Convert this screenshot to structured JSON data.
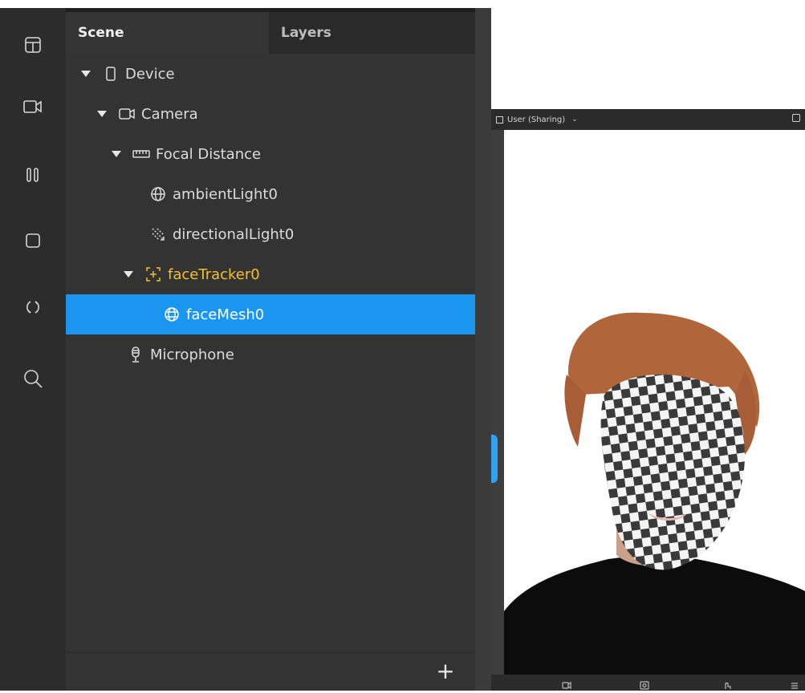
{
  "rail": {
    "icons": [
      "layout-icon",
      "video-camera-icon",
      "pause-bars-icon",
      "square-icon",
      "refresh-icon",
      "search-icon"
    ]
  },
  "tabs": {
    "scene": "Scene",
    "layers": "Layers"
  },
  "tree": {
    "items": [
      {
        "label": "Device",
        "icon": "device-icon",
        "expanded": true
      },
      {
        "label": "Camera",
        "icon": "camera-icon",
        "expanded": true
      },
      {
        "label": "Focal Distance",
        "icon": "ruler-icon",
        "expanded": true
      },
      {
        "label": "ambientLight0",
        "icon": "globe-icon"
      },
      {
        "label": "directionalLight0",
        "icon": "directional-light-icon"
      },
      {
        "label": "faceTracker0",
        "icon": "face-tracker-icon",
        "expanded": true,
        "color": "#f2c12e"
      },
      {
        "label": "faceMesh0",
        "icon": "face-mesh-icon",
        "selected": true
      },
      {
        "label": "Microphone",
        "icon": "microphone-icon"
      }
    ]
  },
  "panel": {
    "add_label": "+"
  },
  "simulator": {
    "device_label": "User (Sharing)",
    "dropdown_glyph": "⌄"
  },
  "colors": {
    "selection": "#1a95f0",
    "tracker": "#f2c12e",
    "panel_bg": "#333333"
  }
}
